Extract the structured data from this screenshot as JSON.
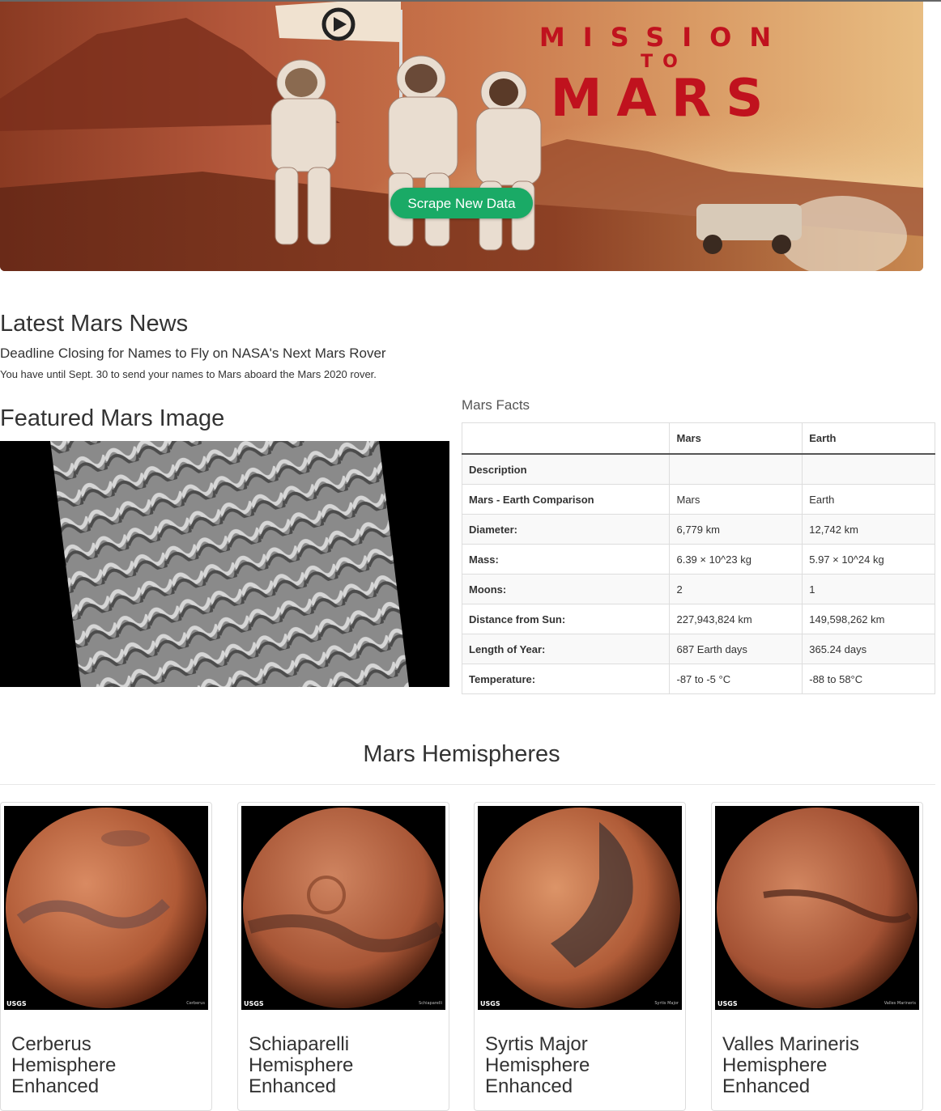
{
  "hero": {
    "title_line1": "MISSION",
    "title_line2": "TO",
    "title_line3": "MARS",
    "button_label": "Scrape New Data",
    "button_color": "#1aaa66",
    "title_color": "#c0121e"
  },
  "news": {
    "heading": "Latest Mars News",
    "title": "Deadline Closing for Names to Fly on NASA's Next Mars Rover",
    "teaser": "You have until Sept. 30 to send your names to Mars aboard the Mars 2020 rover."
  },
  "featured": {
    "heading": "Featured Mars Image"
  },
  "facts": {
    "caption": "Mars Facts",
    "headers": [
      "",
      "Mars",
      "Earth"
    ],
    "rows": [
      [
        "Description",
        "",
        ""
      ],
      [
        "Mars - Earth Comparison",
        "Mars",
        "Earth"
      ],
      [
        "Diameter:",
        "6,779 km",
        "12,742 km"
      ],
      [
        "Mass:",
        "6.39 × 10^23 kg",
        "5.97 × 10^24 kg"
      ],
      [
        "Moons:",
        "2",
        "1"
      ],
      [
        "Distance from Sun:",
        "227,943,824 km",
        "149,598,262 km"
      ],
      [
        "Length of Year:",
        "687 Earth days",
        "365.24 days"
      ],
      [
        "Temperature:",
        "-87 to -5 °C",
        "-88 to 58°C"
      ]
    ]
  },
  "hemispheres": {
    "heading": "Mars Hemispheres",
    "items": [
      {
        "title": "Cerberus Hemisphere Enhanced",
        "usgs": "USGS",
        "caption": "Cerberus"
      },
      {
        "title": "Schiaparelli Hemisphere Enhanced",
        "usgs": "USGS",
        "caption": "Schiaparelli"
      },
      {
        "title": "Syrtis Major Hemisphere Enhanced",
        "usgs": "USGS",
        "caption": "Syrtis Major"
      },
      {
        "title": "Valles Marineris Hemisphere Enhanced",
        "usgs": "USGS",
        "caption": "Valles Marineris"
      }
    ]
  }
}
